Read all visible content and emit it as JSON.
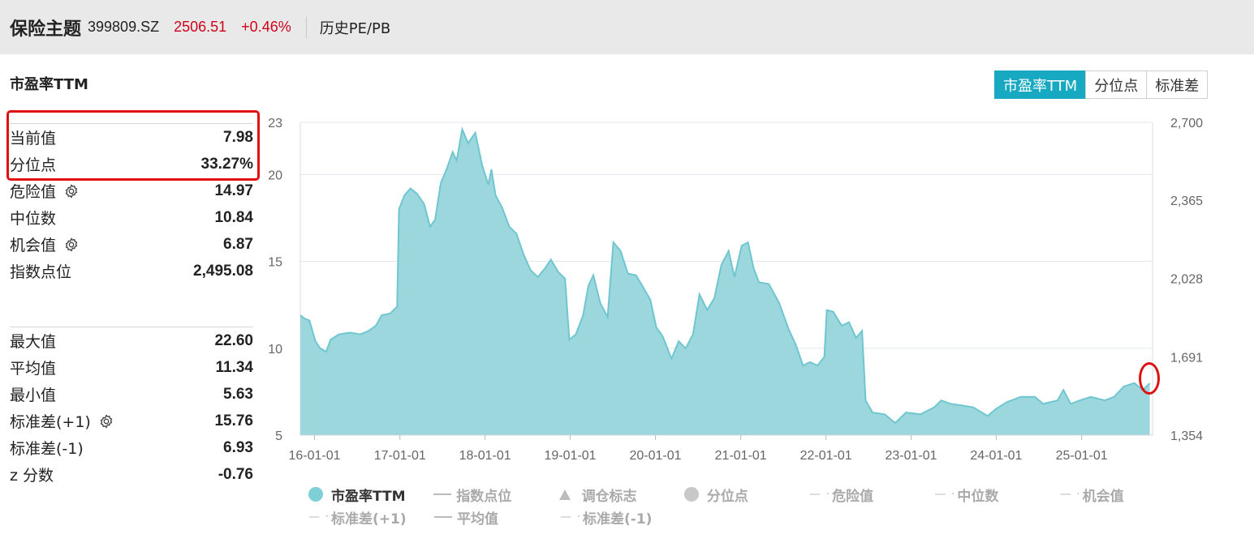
{
  "header": {
    "title": "保险主题",
    "code": "399809.SZ",
    "price": "2506.51",
    "change": "+0.46%",
    "tab": "历史PE/PB"
  },
  "section_title": "市盈率TTM",
  "stats_top": [
    {
      "label": "当前值",
      "value": "7.98",
      "gear": false
    },
    {
      "label": "分位点",
      "value": "33.27%",
      "gear": false
    },
    {
      "label": "危险值",
      "value": "14.97",
      "gear": true
    },
    {
      "label": "中位数",
      "value": "10.84",
      "gear": false
    },
    {
      "label": "机会值",
      "value": "6.87",
      "gear": true
    },
    {
      "label": "指数点位",
      "value": "2,495.08",
      "gear": false
    }
  ],
  "stats_bottom": [
    {
      "label": "最大值",
      "value": "22.60",
      "gear": false
    },
    {
      "label": "平均值",
      "value": "11.34",
      "gear": false
    },
    {
      "label": "最小值",
      "value": "5.63",
      "gear": false
    },
    {
      "label": "标准差(+1)",
      "value": "15.76",
      "gear": true
    },
    {
      "label": "标准差(-1)",
      "value": "6.93",
      "gear": false
    },
    {
      "label": "z 分数",
      "value": "-0.76",
      "gear": false
    }
  ],
  "buttons": [
    {
      "label": "市盈率TTM",
      "active": true
    },
    {
      "label": "分位点",
      "active": false
    },
    {
      "label": "标准差",
      "active": false
    }
  ],
  "legend": [
    {
      "label": "市盈率TTM",
      "symbol": "dot",
      "active": true,
      "color": "#7fcfd6"
    },
    {
      "label": "指数点位",
      "symbol": "line",
      "active": false
    },
    {
      "label": "调仓标志",
      "symbol": "triangle",
      "active": false
    },
    {
      "label": "分位点",
      "symbol": "dot",
      "active": false,
      "color": "#c8c8c8"
    },
    {
      "label": "危险值",
      "symbol": "dashdot",
      "active": false
    },
    {
      "label": "中位数",
      "symbol": "dashdot",
      "active": false
    },
    {
      "label": "机会值",
      "symbol": "dashdot",
      "active": false
    },
    {
      "label": "标准差(+1)",
      "symbol": "dashdot",
      "active": false
    },
    {
      "label": "平均值",
      "symbol": "line",
      "active": false
    },
    {
      "label": "标准差(-1)",
      "symbol": "dashdot",
      "active": false
    }
  ],
  "colors": {
    "accent": "#16a9c1",
    "area_fill": "#9dd7de",
    "area_line": "#6fc6cf",
    "price_red": "#d0021b",
    "highlight_red": "#e01010"
  },
  "chart_data": {
    "type": "area",
    "series_name": "市盈率TTM",
    "ylim": [
      5,
      23
    ],
    "y_ticks": [
      "23",
      "20",
      "15",
      "10",
      "5"
    ],
    "y_tick_values": [
      23,
      20,
      15,
      10,
      5
    ],
    "y2lim": [
      1354,
      2700
    ],
    "y2_ticks": [
      "2,700",
      "2,365",
      "2,028",
      "1,691",
      "1,354"
    ],
    "y2_tick_values": [
      2700,
      2365,
      2028,
      1691,
      1354
    ],
    "x_ticks": [
      "16-01-01",
      "17-01-01",
      "18-01-01",
      "19-01-01",
      "20-01-01",
      "21-01-01",
      "22-01-01",
      "23-01-01",
      "24-01-01",
      "25-01-01"
    ],
    "x_tick_dates": [
      "2016-01-01",
      "2017-01-01",
      "2018-01-01",
      "2019-01-01",
      "2020-01-01",
      "2021-01-01",
      "2022-01-01",
      "2023-01-01",
      "2024-01-01",
      "2025-01-01"
    ],
    "x_range": [
      "2015-11-01",
      "2025-11-01"
    ],
    "points": [
      [
        "2015-11-01",
        11.9
      ],
      [
        "2015-11-20",
        11.7
      ],
      [
        "2015-12-10",
        11.6
      ],
      [
        "2016-01-05",
        10.4
      ],
      [
        "2016-01-25",
        10.0
      ],
      [
        "2016-02-20",
        9.8
      ],
      [
        "2016-03-10",
        10.5
      ],
      [
        "2016-04-15",
        10.8
      ],
      [
        "2016-06-01",
        10.9
      ],
      [
        "2016-07-15",
        10.8
      ],
      [
        "2016-08-20",
        11.0
      ],
      [
        "2016-09-20",
        11.3
      ],
      [
        "2016-10-15",
        11.9
      ],
      [
        "2016-11-20",
        12.0
      ],
      [
        "2016-12-20",
        12.4
      ],
      [
        "2016-12-28",
        18.0
      ],
      [
        "2017-01-20",
        18.8
      ],
      [
        "2017-02-15",
        19.2
      ],
      [
        "2017-03-15",
        18.9
      ],
      [
        "2017-04-15",
        18.3
      ],
      [
        "2017-05-10",
        17.0
      ],
      [
        "2017-06-01",
        17.4
      ],
      [
        "2017-06-25",
        19.5
      ],
      [
        "2017-07-20",
        20.3
      ],
      [
        "2017-08-15",
        21.3
      ],
      [
        "2017-09-01",
        20.8
      ],
      [
        "2017-09-25",
        22.6
      ],
      [
        "2017-10-20",
        21.8
      ],
      [
        "2017-11-20",
        22.4
      ],
      [
        "2017-12-20",
        20.5
      ],
      [
        "2018-01-15",
        19.4
      ],
      [
        "2018-01-28",
        20.3
      ],
      [
        "2018-02-15",
        18.8
      ],
      [
        "2018-03-15",
        18.1
      ],
      [
        "2018-04-15",
        17.0
      ],
      [
        "2018-05-15",
        16.6
      ],
      [
        "2018-06-15",
        15.4
      ],
      [
        "2018-07-15",
        14.5
      ],
      [
        "2018-08-15",
        14.1
      ],
      [
        "2018-09-15",
        14.6
      ],
      [
        "2018-10-10",
        15.1
      ],
      [
        "2018-11-10",
        14.4
      ],
      [
        "2018-12-10",
        14.0
      ],
      [
        "2018-12-28",
        10.5
      ],
      [
        "2019-01-25",
        10.8
      ],
      [
        "2019-02-25",
        11.9
      ],
      [
        "2019-03-20",
        13.6
      ],
      [
        "2019-04-10",
        14.2
      ],
      [
        "2019-05-10",
        12.6
      ],
      [
        "2019-06-10",
        11.8
      ],
      [
        "2019-07-05",
        16.1
      ],
      [
        "2019-08-05",
        15.6
      ],
      [
        "2019-09-05",
        14.3
      ],
      [
        "2019-10-10",
        14.2
      ],
      [
        "2019-11-10",
        13.5
      ],
      [
        "2019-12-10",
        12.8
      ],
      [
        "2020-01-05",
        11.2
      ],
      [
        "2020-02-01",
        10.7
      ],
      [
        "2020-03-10",
        9.4
      ],
      [
        "2020-04-10",
        10.4
      ],
      [
        "2020-05-10",
        10.0
      ],
      [
        "2020-06-10",
        10.8
      ],
      [
        "2020-07-08",
        13.1
      ],
      [
        "2020-08-10",
        12.2
      ],
      [
        "2020-09-10",
        12.9
      ],
      [
        "2020-10-10",
        14.8
      ],
      [
        "2020-11-10",
        15.6
      ],
      [
        "2020-12-05",
        14.1
      ],
      [
        "2021-01-05",
        15.9
      ],
      [
        "2021-02-01",
        16.1
      ],
      [
        "2021-02-25",
        14.6
      ],
      [
        "2021-03-20",
        13.8
      ],
      [
        "2021-05-01",
        13.7
      ],
      [
        "2021-06-15",
        12.6
      ],
      [
        "2021-07-25",
        11.1
      ],
      [
        "2021-08-25",
        10.2
      ],
      [
        "2021-09-25",
        9.0
      ],
      [
        "2021-10-25",
        9.2
      ],
      [
        "2021-11-25",
        9.0
      ],
      [
        "2021-12-25",
        9.5
      ],
      [
        "2022-01-05",
        12.2
      ],
      [
        "2022-02-01",
        12.1
      ],
      [
        "2022-03-10",
        11.3
      ],
      [
        "2022-04-10",
        11.5
      ],
      [
        "2022-05-10",
        10.6
      ],
      [
        "2022-06-05",
        11.0
      ],
      [
        "2022-06-20",
        7.0
      ],
      [
        "2022-07-20",
        6.3
      ],
      [
        "2022-09-10",
        6.2
      ],
      [
        "2022-10-25",
        5.7
      ],
      [
        "2022-12-10",
        6.3
      ],
      [
        "2023-02-10",
        6.2
      ],
      [
        "2023-04-10",
        6.6
      ],
      [
        "2023-05-10",
        7.0
      ],
      [
        "2023-06-20",
        6.8
      ],
      [
        "2023-08-10",
        6.7
      ],
      [
        "2023-09-25",
        6.6
      ],
      [
        "2023-11-25",
        6.1
      ],
      [
        "2023-12-30",
        6.5
      ],
      [
        "2024-02-15",
        6.9
      ],
      [
        "2024-04-15",
        7.2
      ],
      [
        "2024-06-15",
        7.2
      ],
      [
        "2024-07-20",
        6.8
      ],
      [
        "2024-09-20",
        7.0
      ],
      [
        "2024-10-15",
        7.6
      ],
      [
        "2024-11-15",
        6.8
      ],
      [
        "2024-12-25",
        7.0
      ],
      [
        "2025-02-10",
        7.2
      ],
      [
        "2025-04-10",
        7.0
      ],
      [
        "2025-05-20",
        7.2
      ],
      [
        "2025-07-01",
        7.8
      ],
      [
        "2025-08-15",
        8.0
      ],
      [
        "2025-09-20",
        7.6
      ],
      [
        "2025-10-20",
        7.98
      ]
    ]
  }
}
